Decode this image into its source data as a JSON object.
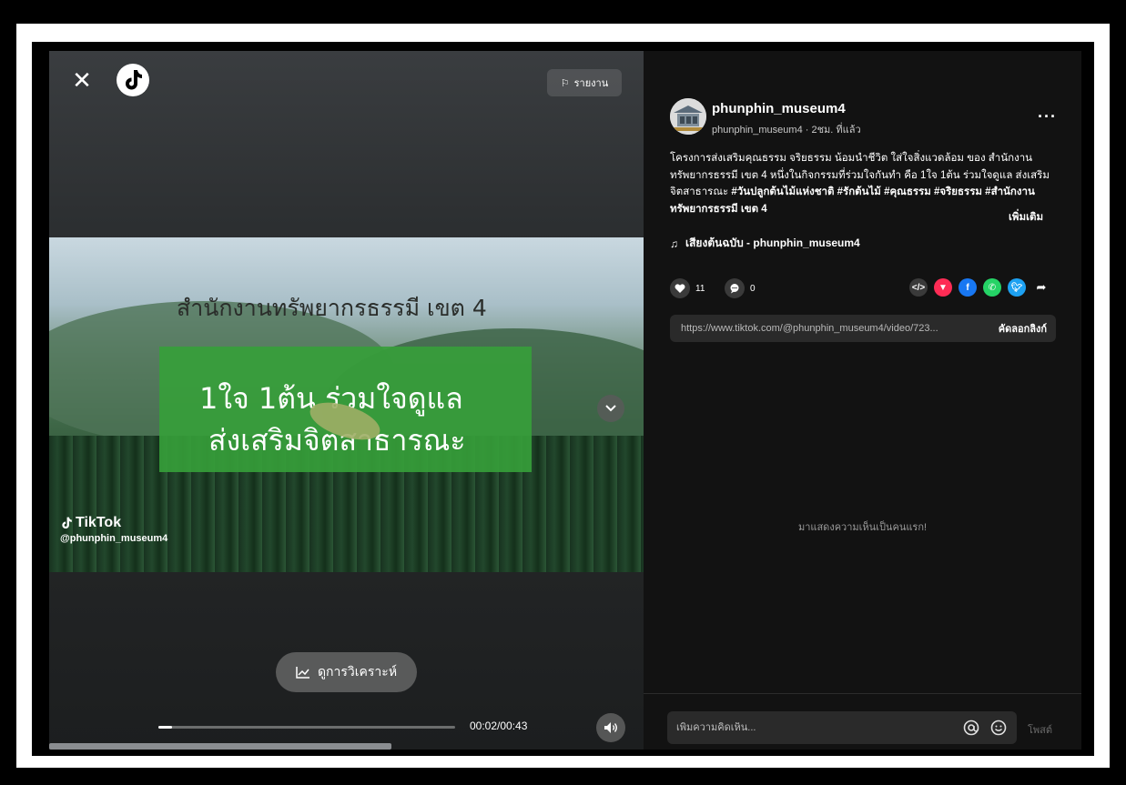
{
  "video": {
    "report_label": "รายงาน",
    "title_text": "สำนักงานทรัพยากรธรรมี เขต 4",
    "overlay_line1": "1ใจ 1ต้น ร่วมใจดูแล",
    "overlay_line2": "ส่งเสริมจิตสาธารณะ",
    "watermark_brand": "TikTok",
    "watermark_user": "@phunphin_museum4",
    "analytics_label": "ดูการวิเคราะห์",
    "timecode": "00:02/00:43",
    "progress": 0.047
  },
  "post": {
    "username": "phunphin_museum4",
    "subline": "phunphin_museum4 · 2ชม. ที่แล้ว",
    "caption_plain": "โครงการส่งเสริมคุณธรรม จริยธรรม น้อมนำชีวิต ใส่ใจสิ่งแวดล้อม ของ สำนักงานทรัพยากรธรรมี เขต 4 หนึ่งในกิจกรรมที่ร่วมใจกันทำ คือ 1ใจ 1ต้น ร่วมใจดูแล ส่งเสริมจิตสาธารณะ ",
    "caption_tags": "#วันปลูกต้นไม้แห่งชาติ #รักต้นไม้ #คุณธรรม #จริยธรรม #สำนักงานทรัพยากรธรรมี เขต 4",
    "see_more": "เพิ่มเติม",
    "sound": "เสียงต้นฉบับ - phunphin_museum4",
    "likes": "11",
    "comments": "0",
    "link": "https://www.tiktok.com/@phunphin_museum4/video/723...",
    "copy_label": "คัดลอกลิงก์",
    "empty_comments": "มาแสดงความเห็นเป็นคนแรก!",
    "comment_placeholder": "เพิ่มความคิดเห็น...",
    "post_label": "โพสต์"
  },
  "colors": {
    "share_embed": "#3a3a3a",
    "share_send": "#fe2c55",
    "share_facebook": "#1877f2",
    "share_whatsapp": "#25d366",
    "share_twitter": "#1da1f2"
  }
}
